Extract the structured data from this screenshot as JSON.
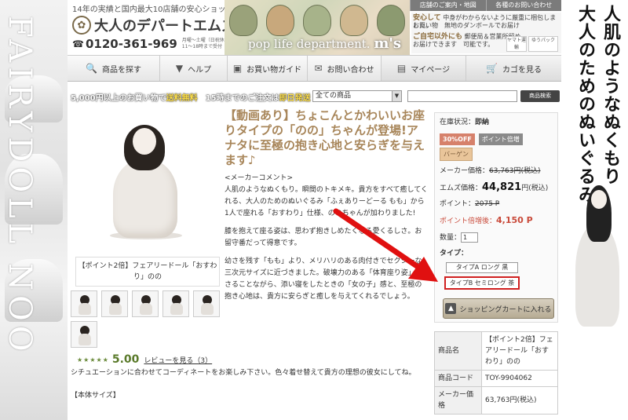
{
  "left_banner": {
    "text": "FAIRYDOLL NOO"
  },
  "right_banner": {
    "line1": "人肌のようなぬくもり",
    "line2": "大人のためのぬいぐるみ"
  },
  "header": {
    "tagline": "14年の実績と国内最大10店舗の安心ショップ",
    "logo": "大人のデパートエムズ",
    "logo_glyph": "✿",
    "phone_glyph": "☎",
    "phone": "0120-361-969",
    "hours": "月曜～土曜（日祝休）11～18時まで受付",
    "art_title_small": "pop life department.",
    "art_title_big": "m's",
    "links": [
      "店舗のご案内・地図",
      "各種のお問い合わせ"
    ],
    "info1_title": "安心して",
    "info1_text": "中身がわからないように厳重に梱包しました。",
    "info1_text2": "お買い物　無地のダンボールでお届け",
    "info2_title": "ご自宅以外にも",
    "info2_text": "郵便局＆営業所留め",
    "info2_text2": "お届けできます　可能です。",
    "badge1": "ヤマト運輸",
    "badge2": "ゆうパック"
  },
  "nav": {
    "items": [
      {
        "label": "商品を探す",
        "icon": "🔍"
      },
      {
        "label": "ヘルプ",
        "icon": "▼"
      },
      {
        "label": "お買い物ガイド",
        "icon": "▣"
      },
      {
        "label": "お問い合わせ",
        "icon": "✉"
      },
      {
        "label": "マイページ",
        "icon": "▤"
      },
      {
        "label": "カゴを見る",
        "icon": "🛒"
      }
    ]
  },
  "promo": {
    "part1": "5,000円以上のお買い物で",
    "part2": "送料無料",
    "part3": "15時までのご注文は",
    "part4": "即日発送"
  },
  "search": {
    "category": "全ての商品",
    "placeholder": "",
    "button": "商品検索"
  },
  "product": {
    "caption": "【ポイント2倍】フェアリードール「おすわり」のの",
    "rating": "5.00",
    "stars": "★★★★★",
    "review_link": "レビューを見る（3）",
    "title": "【動画あり】ちょこんとかわいいお座りタイプの「のの」ちゃんが登場!アナタに至極の抱き心地と安らぎを与えます♪",
    "maker_comment_label": "<メーカーコメント>",
    "para1": "人肌のようなぬくもり。瞬間のトキメキ。貴方をすべて癒してくれる、大人のためのぬいぐるみ「ふぇありーどーる もも」から1人で座れる「おすわり」仕様、ののちゃんが加わりました!",
    "para2": "膝を抱えて座る姿は、思わず抱きしめたくなる愛くるしさ。お留守番だって得意です。",
    "para3": "幼さを残す「もも」より、メリハリのある肉付きでセクシーな三次元サイズに近づきました。破壊力のある「体育座り姿」もさることながら、添い寝をしたときの「女の子」感と、至極の抱き心地は、貴方に安らぎと癒しを与えてくれるでしょう。",
    "para4": "シチュエーションに合わせてコーディネートをお楽しみ下さい。色々着せ替えて貴方の理想の彼女にしてね。",
    "size_label": "【本体サイズ】"
  },
  "buybox": {
    "stock_label": "在庫状況：",
    "stock_value": "即納",
    "badge_off": "30%OFF",
    "badge_point": "ポイント倍増",
    "badge_bargain": "バーゲン",
    "maker_price_label": "メーカー価格：",
    "maker_price": "63,763円(税込)",
    "ms_price_label": "エムズ価格：",
    "ms_price": "44,821",
    "ms_price_unit": "円(税込)",
    "point_label": "ポイント：",
    "point_old": "2075 P",
    "point_after_label": "ポイント倍増後：",
    "point_after": "4,150 P",
    "qty_label": "数量：",
    "qty_value": "1",
    "type_label": "タイプ：",
    "types": [
      "タイプA ロング 黒",
      "タイプB セミロング 茶"
    ],
    "cart_button": "ショッピングカートに入れる",
    "cart_icon": "▲"
  },
  "spec": {
    "rows": [
      {
        "k": "商品名",
        "v": "【ポイント2倍】フェアリードール「おすわり」のの"
      },
      {
        "k": "商品コード",
        "v": "TOY-9904062"
      },
      {
        "k": "メーカー価格",
        "v": "63,763円(税込)"
      }
    ]
  },
  "colors": {
    "title": "#a8865a",
    "accent_red": "#d02020",
    "point_red": "#c94a3a"
  }
}
